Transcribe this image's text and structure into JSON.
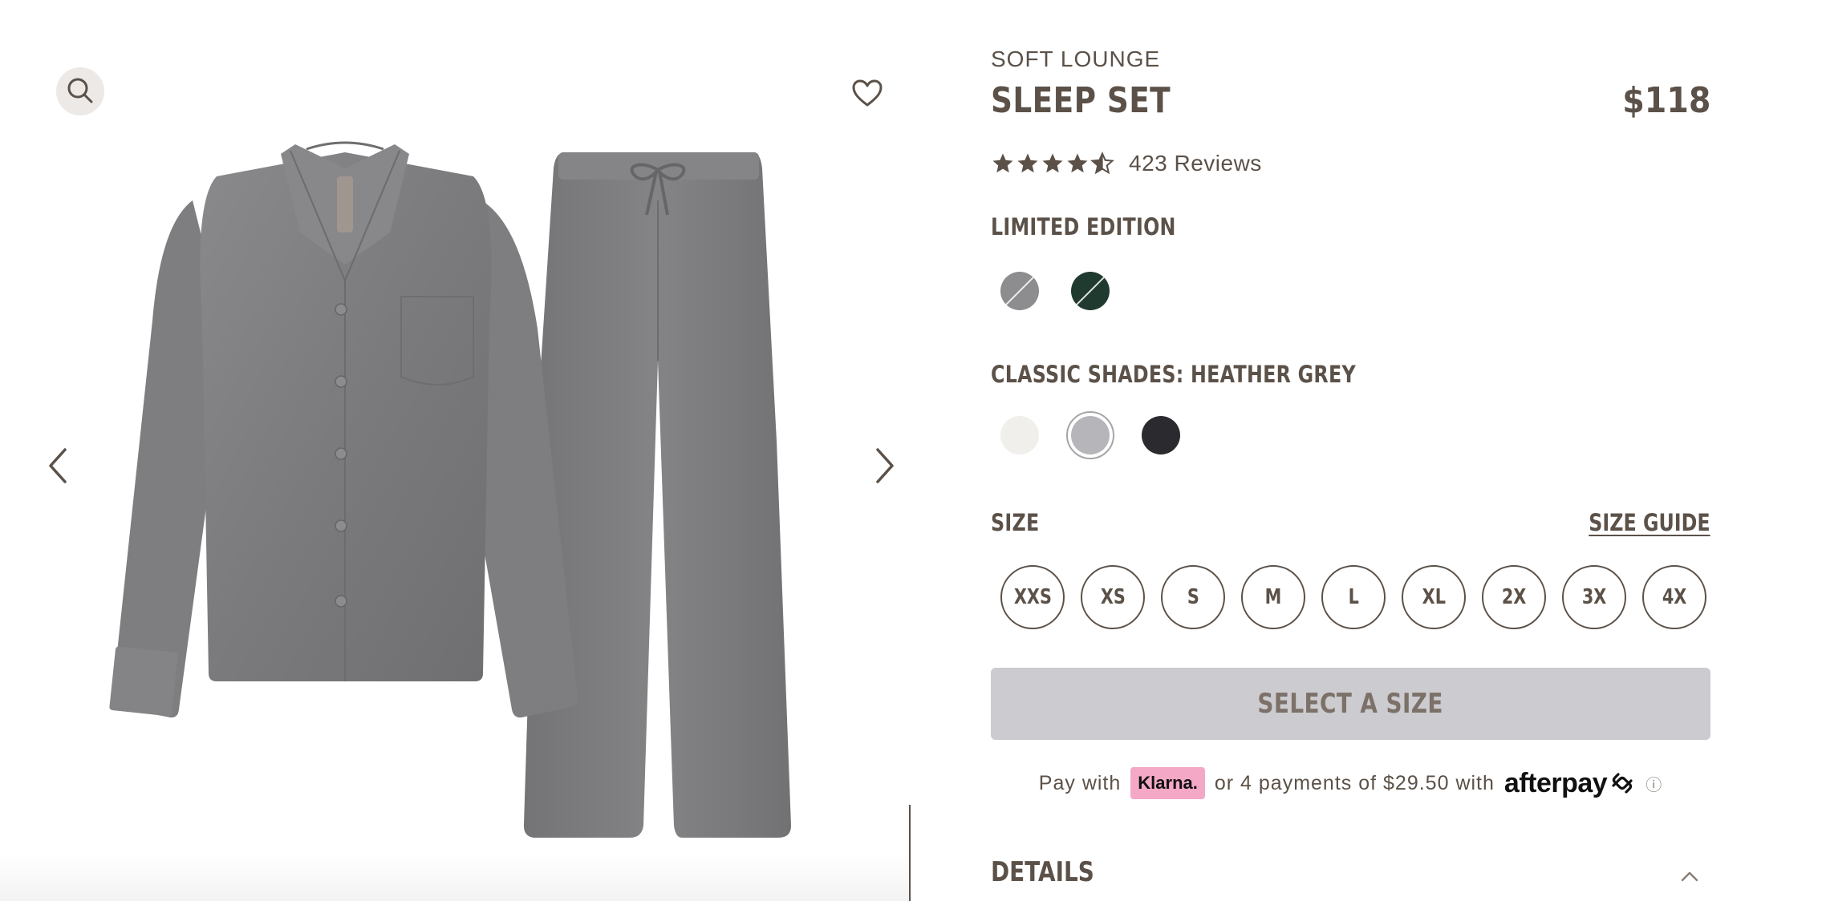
{
  "gallery": {
    "zoom_icon": "search-icon",
    "wishlist_icon": "heart-outline-icon",
    "prev_icon": "chevron-left-icon",
    "next_icon": "chevron-right-icon",
    "image_alt": "Heather grey button-up pajama shirt and drawstring pants"
  },
  "product": {
    "collection": "SOFT LOUNGE",
    "name": "SLEEP SET",
    "price": "$118",
    "rating": 4.5,
    "reviews": "423 Reviews"
  },
  "limited_edition": {
    "label": "LIMITED EDITION",
    "swatches": [
      {
        "color": "#8d8c8e",
        "out_of_stock": true
      },
      {
        "color": "#203a30",
        "out_of_stock": true
      }
    ]
  },
  "classic_shades": {
    "label": "CLASSIC SHADES: HEATHER GREY",
    "swatches": [
      {
        "color": "#f1efeb",
        "selected": false
      },
      {
        "color": "#b6b6ba",
        "selected": true
      },
      {
        "color": "#2b2a2f",
        "selected": false
      }
    ]
  },
  "size": {
    "label": "SIZE",
    "guide_label": "SIZE GUIDE",
    "options": [
      "XXS",
      "XS",
      "S",
      "M",
      "L",
      "XL",
      "2X",
      "3X",
      "4X"
    ]
  },
  "cta": {
    "label": "SELECT A SIZE",
    "background": "#cccbcf"
  },
  "payment": {
    "prefix": "Pay with",
    "klarna": "Klarna.",
    "middle": "or 4 payments of $29.50 with",
    "afterpay": "afterpay",
    "info_glyph": "ⓘ"
  },
  "details": {
    "label": "DETAILS",
    "chevron_icon": "chevron-up-icon"
  },
  "colors": {
    "text": "#5b5148",
    "klarna_pink": "#f4a8c6"
  }
}
